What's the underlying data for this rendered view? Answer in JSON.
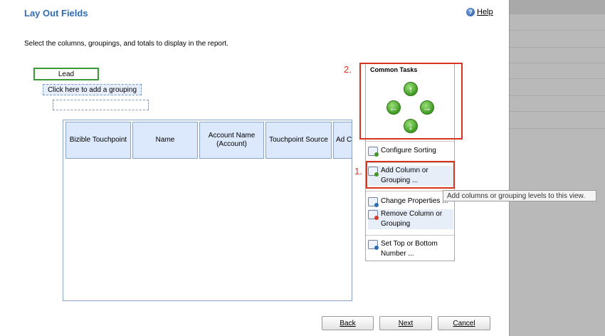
{
  "dialog": {
    "title": "Lay Out Fields",
    "help_label": "Help",
    "instruction": "Select the columns, groupings, and totals to display in the report."
  },
  "layout": {
    "lead_label": "Lead",
    "grouping_prompt": "Click here to add a grouping",
    "columns": [
      "Bizible Touchpoint",
      "Name",
      "Account Name\n(Account)",
      "Touchpoint Source",
      "Ad Ca"
    ]
  },
  "tasks": {
    "title": "Common Tasks",
    "arrows": {
      "up": "↑",
      "left": "←",
      "right": "→",
      "down": "↓"
    },
    "items": [
      {
        "label": "Configure Sorting",
        "icon": "sort-icon"
      },
      {
        "label": "Add Column or Grouping ...",
        "icon": "add-column-icon"
      },
      {
        "label": "Change Properties ...",
        "icon": "properties-icon"
      },
      {
        "label": "Remove Column or Grouping",
        "icon": "remove-column-icon"
      },
      {
        "label": "Set Top or Bottom Number ...",
        "icon": "top-bottom-icon"
      }
    ]
  },
  "annotations": {
    "step1": "1.",
    "step2": "2.",
    "color": "#d9321f"
  },
  "tooltip": "Add columns or grouping levels to this view.",
  "buttons": {
    "back": "Back",
    "next": "Next",
    "cancel": "Cancel"
  },
  "colors": {
    "title": "#2e6db4",
    "lead_border": "#3a9a3a",
    "column_header_bg": "#dce8fb",
    "arrow_green": "#3f9a22"
  }
}
